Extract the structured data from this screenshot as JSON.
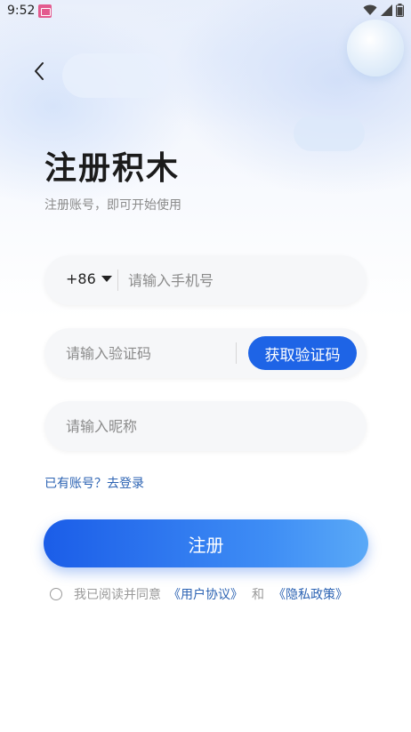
{
  "status_bar": {
    "time": "9:52"
  },
  "header": {
    "title": "注册积木",
    "subtitle": "注册账号，即可开始使用"
  },
  "form": {
    "country_code": "+86",
    "phone_placeholder": "请输入手机号",
    "code_placeholder": "请输入验证码",
    "get_code_label": "获取验证码",
    "nickname_placeholder": "请输入昵称"
  },
  "login_link": "已有账号？去登录",
  "register_label": "注册",
  "agreement": {
    "prefix": "我已阅读并同意",
    "user_agreement": "《用户协议》",
    "and": "和",
    "privacy_policy": "《隐私政策》"
  },
  "colors": {
    "accent": "#1e64e6",
    "link": "#2c63b3"
  },
  "icons": [
    "back-chevron-icon",
    "wifi-icon",
    "signal-icon",
    "battery-icon",
    "dropdown-caret-icon",
    "checkbox-circle-icon"
  ]
}
